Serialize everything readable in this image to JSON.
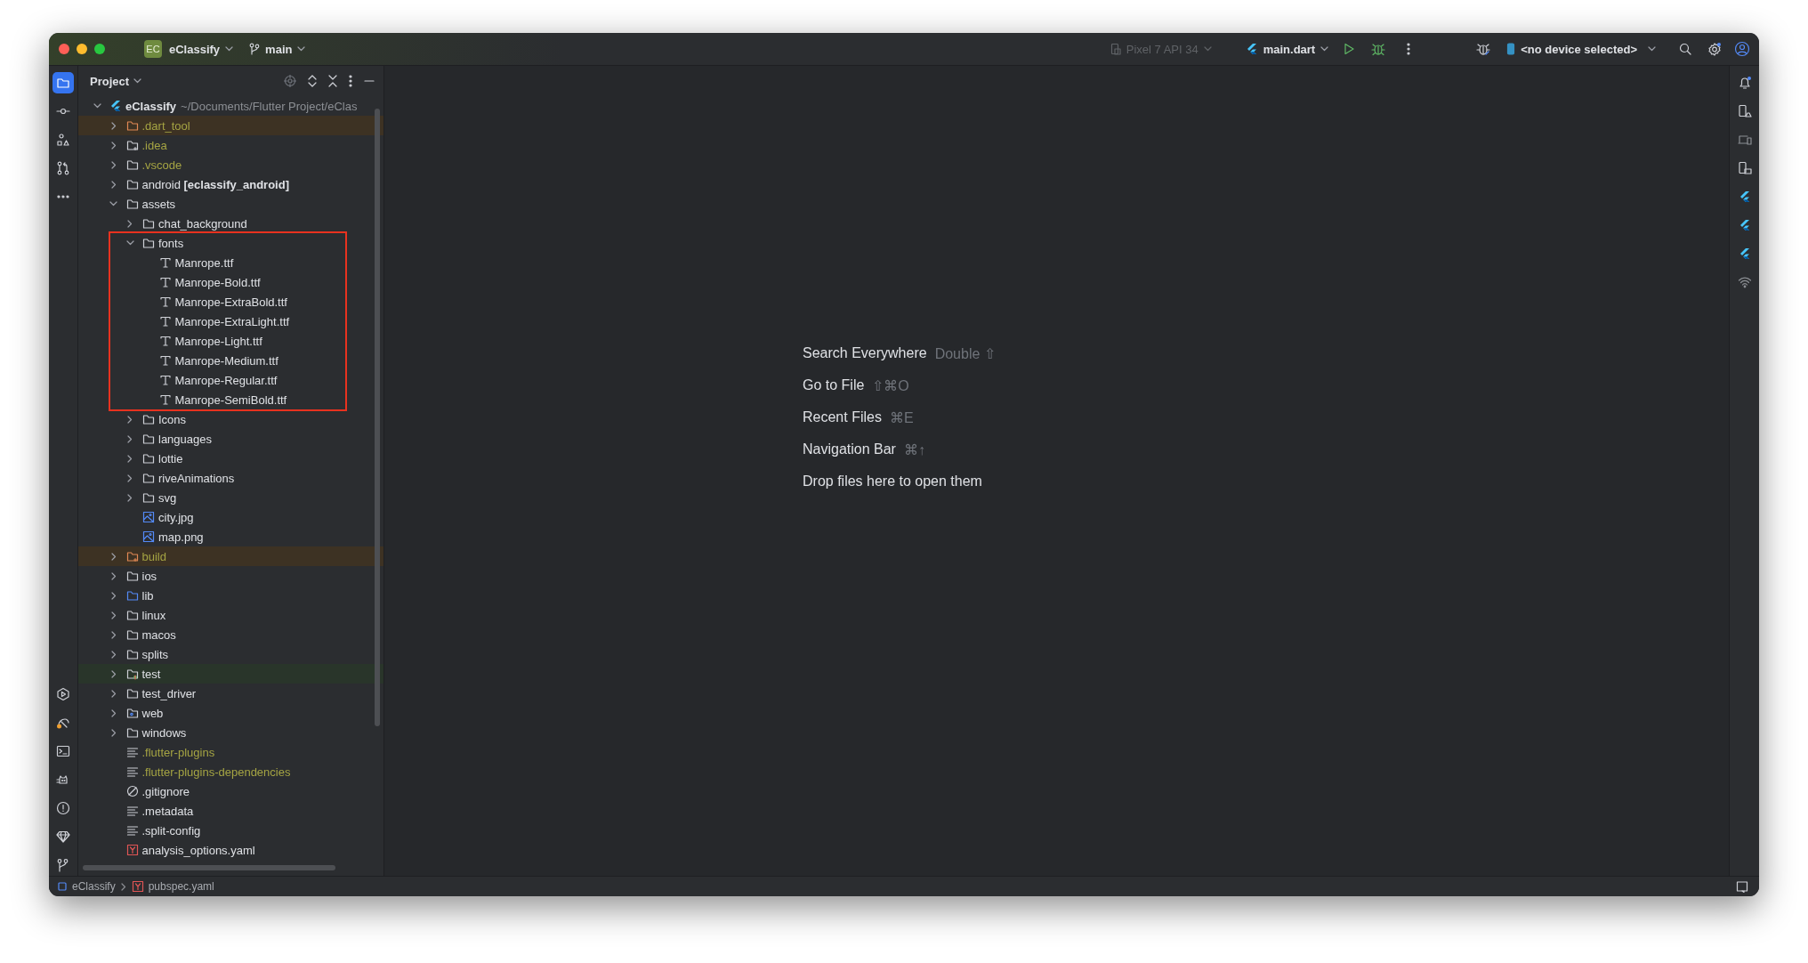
{
  "title_bar": {
    "project": {
      "badge": "EC",
      "name": "eClassify"
    },
    "branch": "main",
    "device_config": {
      "label": "Pixel 7 API 34",
      "disabled": true
    },
    "run_config": "main.dart",
    "device": "<no device selected>"
  },
  "project_panel": {
    "title": "Project",
    "root": {
      "name": "eClassify",
      "path": "~/Documents/Flutter Project/eClas",
      "kind": "flutter",
      "expanded": true,
      "ignored": false,
      "excluded": false,
      "children": [
        {
          "name": ".dart_tool",
          "kind": "folder",
          "expanded": false,
          "ignored": true,
          "excluded": true
        },
        {
          "name": ".idea",
          "kind": "config_folder",
          "expanded": false,
          "ignored": true,
          "excluded": false
        },
        {
          "name": ".vscode",
          "kind": "folder",
          "expanded": false,
          "ignored": true,
          "excluded": false
        },
        {
          "name": "android **[eclassify_android]**",
          "kind": "folder",
          "expanded": false,
          "ignored": false,
          "excluded": false
        },
        {
          "name": "assets",
          "kind": "folder",
          "expanded": true,
          "ignored": false,
          "excluded": false,
          "children": [
            {
              "name": "chat_background",
              "kind": "folder",
              "expanded": false,
              "ignored": false,
              "excluded": false
            },
            {
              "name": "fonts",
              "kind": "folder",
              "expanded": true,
              "ignored": false,
              "excluded": false,
              "boxed": true,
              "children": [
                {
                  "name": "Manrope.ttf",
                  "kind": "font",
                  "ignored": false,
                  "excluded": false
                },
                {
                  "name": "Manrope-Bold.ttf",
                  "kind": "font",
                  "ignored": false,
                  "excluded": false
                },
                {
                  "name": "Manrope-ExtraBold.ttf",
                  "kind": "font",
                  "ignored": false,
                  "excluded": false
                },
                {
                  "name": "Manrope-ExtraLight.ttf",
                  "kind": "font",
                  "ignored": false,
                  "excluded": false
                },
                {
                  "name": "Manrope-Light.ttf",
                  "kind": "font",
                  "ignored": false,
                  "excluded": false
                },
                {
                  "name": "Manrope-Medium.ttf",
                  "kind": "font",
                  "ignored": false,
                  "excluded": false
                },
                {
                  "name": "Manrope-Regular.ttf",
                  "kind": "font",
                  "ignored": false,
                  "excluded": false
                },
                {
                  "name": "Manrope-SemiBold.ttf",
                  "kind": "font",
                  "ignored": false,
                  "excluded": false
                }
              ]
            },
            {
              "name": "Icons",
              "kind": "folder",
              "expanded": false,
              "ignored": false,
              "excluded": false
            },
            {
              "name": "languages",
              "kind": "folder",
              "expanded": false,
              "ignored": false,
              "excluded": false
            },
            {
              "name": "lottie",
              "kind": "folder",
              "expanded": false,
              "ignored": false,
              "excluded": false
            },
            {
              "name": "riveAnimations",
              "kind": "folder",
              "expanded": false,
              "ignored": false,
              "excluded": false
            },
            {
              "name": "svg",
              "kind": "folder",
              "expanded": false,
              "ignored": false,
              "excluded": false
            },
            {
              "name": "city.jpg",
              "kind": "image",
              "ignored": false,
              "excluded": false
            },
            {
              "name": "map.png",
              "kind": "image",
              "ignored": false,
              "excluded": false
            }
          ]
        },
        {
          "name": "build",
          "kind": "config_folder",
          "expanded": false,
          "ignored": true,
          "excluded": true
        },
        {
          "name": "ios",
          "kind": "folder",
          "expanded": false,
          "ignored": false,
          "excluded": false
        },
        {
          "name": "lib",
          "kind": "source_folder",
          "expanded": false,
          "ignored": false,
          "excluded": false
        },
        {
          "name": "linux",
          "kind": "folder",
          "expanded": false,
          "ignored": false,
          "excluded": false
        },
        {
          "name": "macos",
          "kind": "folder",
          "expanded": false,
          "ignored": false,
          "excluded": false
        },
        {
          "name": "splits",
          "kind": "folder",
          "expanded": false,
          "ignored": false,
          "excluded": false
        },
        {
          "name": "test",
          "kind": "test_folder",
          "expanded": false,
          "ignored": false,
          "excluded": false
        },
        {
          "name": "test_driver",
          "kind": "folder",
          "expanded": false,
          "ignored": false,
          "excluded": false
        },
        {
          "name": "web",
          "kind": "web_folder",
          "expanded": false,
          "ignored": false,
          "excluded": false
        },
        {
          "name": "windows",
          "kind": "folder",
          "expanded": false,
          "ignored": false,
          "excluded": false
        },
        {
          "name": ".flutter-plugins",
          "kind": "text",
          "ignored": true,
          "excluded": false
        },
        {
          "name": ".flutter-plugins-dependencies",
          "kind": "text",
          "ignored": true,
          "excluded": false
        },
        {
          "name": ".gitignore",
          "kind": "ignore",
          "ignored": false,
          "excluded": false
        },
        {
          "name": ".metadata",
          "kind": "text",
          "ignored": false,
          "excluded": false
        },
        {
          "name": ".split-config",
          "kind": "text",
          "ignored": false,
          "excluded": false
        },
        {
          "name": "analysis_options.yaml",
          "kind": "yaml",
          "ignored": false,
          "excluded": false
        }
      ]
    }
  },
  "welcome": {
    "actions": [
      {
        "label": "Search Everywhere",
        "shortcut": "Double ⇧"
      },
      {
        "label": "Go to File",
        "shortcut": "⇧⌘O"
      },
      {
        "label": "Recent Files",
        "shortcut": "⌘E"
      },
      {
        "label": "Navigation Bar",
        "shortcut": "⌘↑"
      }
    ],
    "hint": "Drop files here to open them"
  },
  "status_bar": {
    "breadcrumbs": [
      {
        "label": "eClassify",
        "kind": "module"
      },
      {
        "label": "pubspec.yaml",
        "kind": "yaml"
      }
    ]
  }
}
